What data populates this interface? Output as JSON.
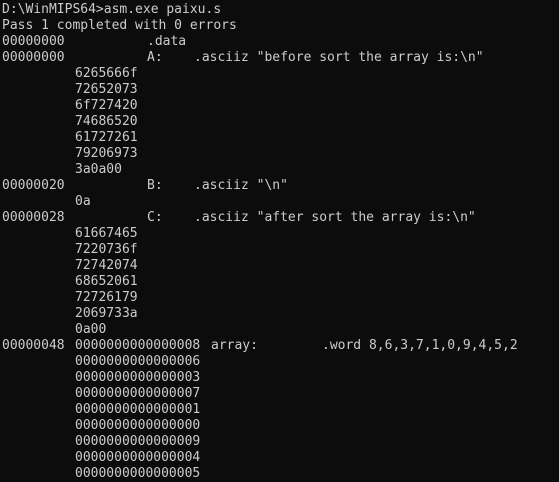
{
  "console": {
    "prompt": "D:\\WinMIPS64>asm.exe paixu.s",
    "status": "Pass 1 completed with 0 errors",
    "lines": [
      {
        "addr": "00000000",
        "hex": "",
        "label": "",
        "directive": ".data"
      },
      {
        "addr": "00000000",
        "hex": "",
        "label": "A:",
        "directive": ".asciiz \"before sort the array is:\\n\""
      },
      {
        "addr": "",
        "hex": "6265666f"
      },
      {
        "addr": "",
        "hex": "72652073"
      },
      {
        "addr": "",
        "hex": "6f727420"
      },
      {
        "addr": "",
        "hex": "74686520"
      },
      {
        "addr": "",
        "hex": "61727261"
      },
      {
        "addr": "",
        "hex": "79206973"
      },
      {
        "addr": "",
        "hex": "3a0a00"
      },
      {
        "addr": "00000020",
        "hex": "",
        "label": "B:",
        "directive": ".asciiz \"\\n\""
      },
      {
        "addr": "",
        "hex": "0a"
      },
      {
        "addr": "00000028",
        "hex": "",
        "label": "C:",
        "directive": ".asciiz \"after sort the array is:\\n\""
      },
      {
        "addr": "",
        "hex": "61667465"
      },
      {
        "addr": "",
        "hex": "7220736f"
      },
      {
        "addr": "",
        "hex": "72742074"
      },
      {
        "addr": "",
        "hex": "68652061"
      },
      {
        "addr": "",
        "hex": "72726179"
      },
      {
        "addr": "",
        "hex": "2069733a"
      },
      {
        "addr": "",
        "hex": "0a00"
      },
      {
        "addr": "00000048",
        "hex": "0000000000000008",
        "label": "array:",
        "directive": ".word 8,6,3,7,1,0,9,4,5,2"
      },
      {
        "addr": "",
        "hex": "0000000000000006"
      },
      {
        "addr": "",
        "hex": "0000000000000003"
      },
      {
        "addr": "",
        "hex": "0000000000000007"
      },
      {
        "addr": "",
        "hex": "0000000000000001"
      },
      {
        "addr": "",
        "hex": "0000000000000000"
      },
      {
        "addr": "",
        "hex": "0000000000000009"
      },
      {
        "addr": "",
        "hex": "0000000000000004"
      },
      {
        "addr": "",
        "hex": "0000000000000005"
      }
    ]
  }
}
